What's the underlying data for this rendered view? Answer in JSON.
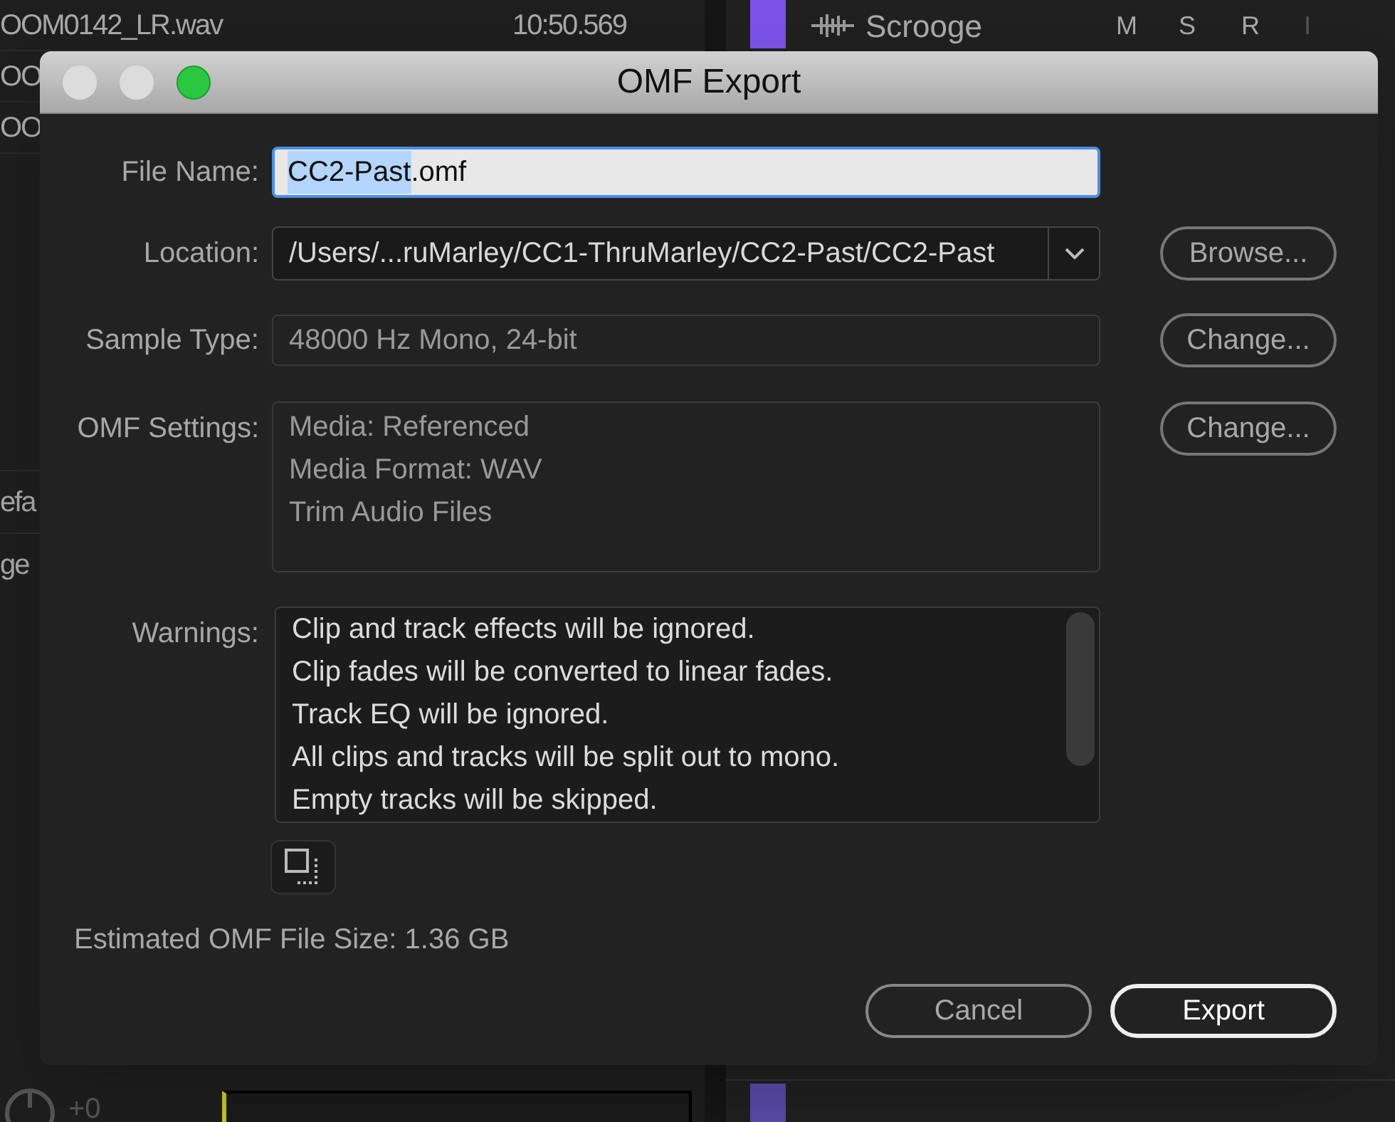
{
  "background": {
    "clips": [
      {
        "name": "OOM0142_LR.wav",
        "time": "10:50.569"
      },
      {
        "name": "OO"
      },
      {
        "name": "OO"
      }
    ],
    "side_items": [
      "efa",
      "ge"
    ],
    "volume": "+0",
    "track": {
      "name": "Scrooge",
      "buttons": [
        {
          "label": "M",
          "disabled": false
        },
        {
          "label": "S",
          "disabled": false
        },
        {
          "label": "R",
          "disabled": false
        },
        {
          "label": "I",
          "disabled": true
        }
      ]
    }
  },
  "dialog": {
    "title": "OMF Export",
    "window_buttons": [
      {
        "kind": "close",
        "enabled": false
      },
      {
        "kind": "minimize",
        "enabled": false
      },
      {
        "kind": "zoom",
        "enabled": true
      }
    ],
    "file_name": {
      "label": "File Name:",
      "parts": [
        {
          "text": "CC2-Past",
          "selected": true
        },
        {
          "text": ".omf",
          "selected": false
        }
      ]
    },
    "location": {
      "label": "Location:",
      "value": "/Users/...ruMarley/CC1-ThruMarley/CC2-Past/CC2-Past",
      "button": "Browse..."
    },
    "sample_type": {
      "label": "Sample Type:",
      "value": "48000 Hz Mono, 24-bit",
      "button": "Change..."
    },
    "omf_settings": {
      "label": "OMF Settings:",
      "lines": [
        "Media: Referenced",
        "Media Format: WAV",
        "Trim Audio Files"
      ],
      "button": "Change..."
    },
    "warnings": {
      "label": "Warnings:",
      "lines": [
        "Clip and track effects will be ignored.",
        "Clip fades will be converted to linear fades.",
        "Track EQ will be ignored.",
        "All clips and tracks will be split out to mono.",
        "Empty tracks will be skipped."
      ]
    },
    "estimate": "Estimated OMF File Size: 1.36 GB",
    "buttons": [
      {
        "label": "Cancel",
        "default": false
      },
      {
        "label": "Export",
        "default": true
      }
    ]
  }
}
